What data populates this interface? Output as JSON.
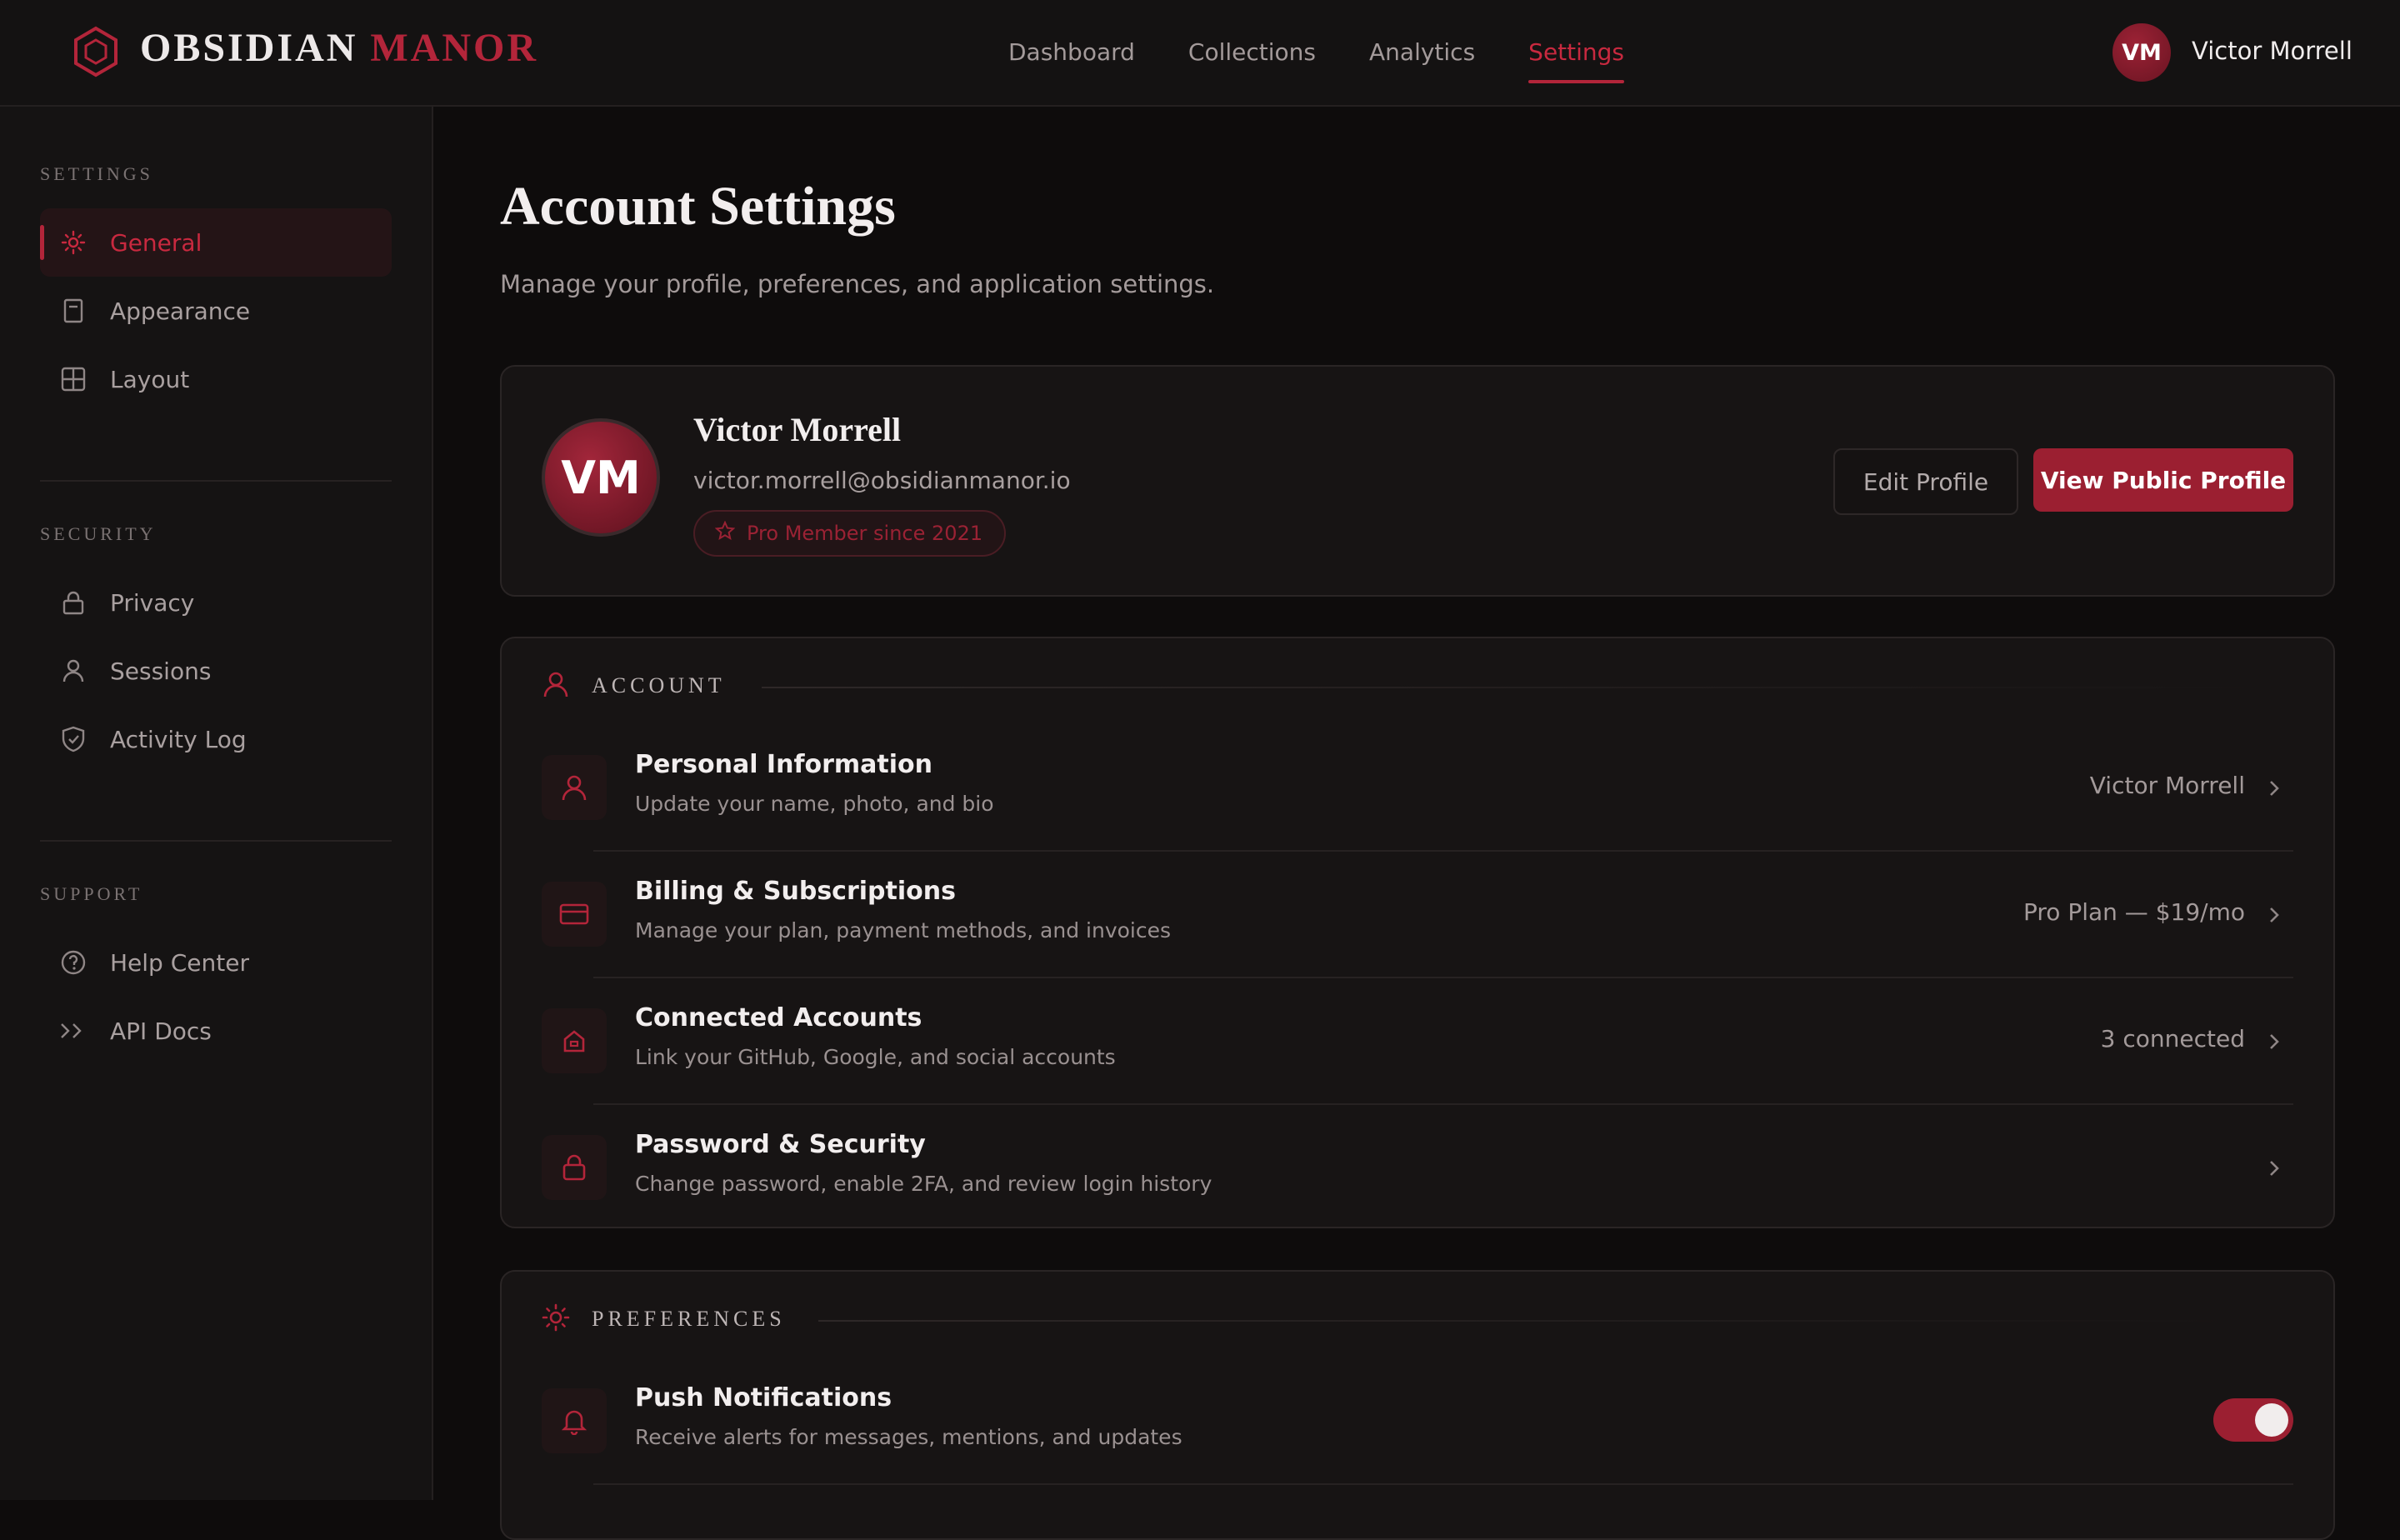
{
  "brand": {
    "word1": "OBSIDIAN",
    "word2": "MANOR"
  },
  "nav": [
    {
      "label": "Dashboard"
    },
    {
      "label": "Collections"
    },
    {
      "label": "Analytics"
    },
    {
      "label": "Settings",
      "active": true
    }
  ],
  "user": {
    "initials": "VM",
    "name": "Victor Morrell",
    "email": "victor.morrell@obsidianmanor.io",
    "badge": "Pro Member since 2021"
  },
  "sidebar": {
    "sections": [
      {
        "title": "SETTINGS",
        "items": [
          {
            "label": "General",
            "icon": "gear-icon",
            "active": true
          },
          {
            "label": "Appearance",
            "icon": "document-icon"
          },
          {
            "label": "Layout",
            "icon": "grid-icon"
          }
        ]
      },
      {
        "title": "SECURITY",
        "items": [
          {
            "label": "Privacy",
            "icon": "lock-icon"
          },
          {
            "label": "Sessions",
            "icon": "user-icon"
          },
          {
            "label": "Activity Log",
            "icon": "shield-icon"
          }
        ]
      },
      {
        "title": "SUPPORT",
        "items": [
          {
            "label": "Help Center",
            "icon": "help-circle-icon"
          },
          {
            "label": "API Docs",
            "icon": "code-chevrons-icon"
          }
        ]
      }
    ]
  },
  "page": {
    "title": "Account Settings",
    "subtitle": "Manage your profile, preferences, and application settings."
  },
  "profile": {
    "edit_label": "Edit Profile",
    "view_label": "View Public Profile"
  },
  "account": {
    "title": "ACCOUNT",
    "rows": [
      {
        "title": "Personal Information",
        "desc": "Update your name, photo, and bio",
        "value": "Victor Morrell",
        "icon": "user-icon"
      },
      {
        "title": "Billing & Subscriptions",
        "desc": "Manage your plan, payment methods, and invoices",
        "value": "Pro Plan — $19/mo",
        "icon": "credit-card-icon"
      },
      {
        "title": "Connected Accounts",
        "desc": "Link your GitHub, Google, and social accounts",
        "value": "3 connected",
        "icon": "house-icon"
      },
      {
        "title": "Password & Security",
        "desc": "Change password, enable 2FA, and review login history",
        "value": "",
        "icon": "lock-icon"
      }
    ]
  },
  "preferences": {
    "title": "PREFERENCES",
    "rows": [
      {
        "title": "Push Notifications",
        "desc": "Receive alerts for messages, mentions, and updates",
        "icon": "bell-icon",
        "enabled": true
      }
    ]
  },
  "colors": {
    "accent": "#9b1f31",
    "accent_text": "#c8293f",
    "background": "#0e0c0c",
    "panel": "#171414"
  }
}
